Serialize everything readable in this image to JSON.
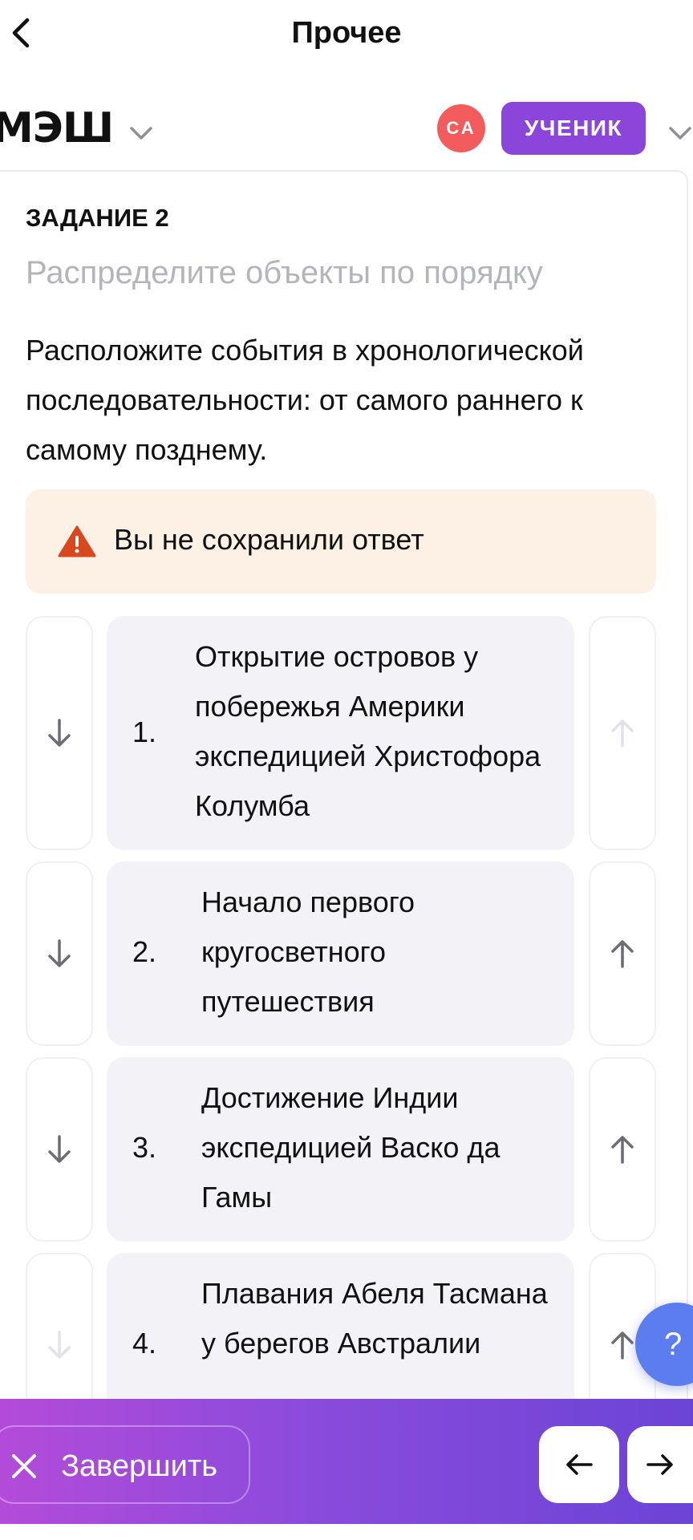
{
  "topnav": {
    "title": "Прочее",
    "back_icon": "chevron-left-icon"
  },
  "header": {
    "logo": "МЭШ",
    "avatar_initials": "СА",
    "role": "УЧЕНИК",
    "colors": {
      "avatar": "#f25c5c",
      "role": "#8c45db"
    }
  },
  "task": {
    "label": "ЗАДАНИЕ 2",
    "subtitle": "Распределите объекты по порядку",
    "question": "Расположите события в хронологической последовательности: от самого раннего к самому позднему.",
    "warning": "Вы не сохранили ответ",
    "warning_icon": "warning-triangle-icon",
    "warning_color": "#d9481c",
    "items": [
      {
        "number": "1.",
        "text": "Открытие островов у побережья Америки экспедицией Христофора Колумба",
        "up_enabled": false,
        "down_enabled": true
      },
      {
        "number": "2.",
        "text": "Начало первого кругосветного путешествия",
        "up_enabled": true,
        "down_enabled": true
      },
      {
        "number": "3.",
        "text": "Достижение Индии экспедицией Васко да Гамы",
        "up_enabled": true,
        "down_enabled": true
      },
      {
        "number": "4.",
        "text": "Плавания Абеля Тасмана у берегов Австралии",
        "up_enabled": true,
        "down_enabled": false
      }
    ]
  },
  "bottom": {
    "finish_label": "Завершить",
    "prev_icon": "arrow-left-icon",
    "next_icon": "arrow-right-icon"
  },
  "help": {
    "label": "?"
  }
}
